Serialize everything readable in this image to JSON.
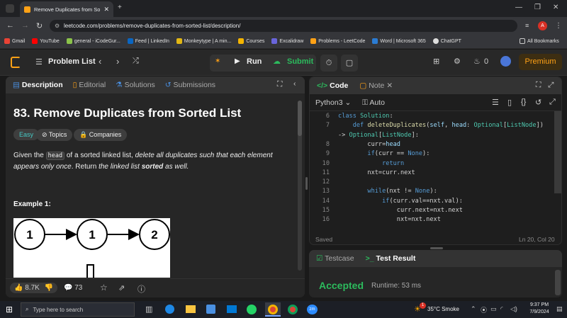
{
  "browser": {
    "tab_title": "Remove Duplicates from Sorte...",
    "url": "leetcode.com/problems/remove-duplicates-from-sorted-list/description/",
    "profile_initial": "A",
    "bookmarks": [
      "Gmail",
      "YouTube",
      "general - iCodeGur...",
      "Feed | LinkedIn",
      "Monkeytype | A min...",
      "Courses",
      "Excalidraw",
      "Problems - LeetCode",
      "Word | Microsoft 365",
      "ChatGPT"
    ],
    "all_bookmarks": "All Bookmarks"
  },
  "nav": {
    "problem_list": "Problem List",
    "run": "Run",
    "submit": "Submit",
    "streak": "0",
    "premium": "Premium"
  },
  "desc": {
    "tabs": [
      "Description",
      "Editorial",
      "Solutions",
      "Submissions"
    ],
    "title": "83. Remove Duplicates from Sorted List",
    "tag_easy": "Easy",
    "tag_topics": "Topics",
    "tag_companies": "Companies",
    "p_a": "Given the ",
    "p_code": "head",
    "p_b": " of a sorted linked list, ",
    "p_i1": "delete all duplicates such that each element appears only once",
    "p_c": ". Return ",
    "p_i2": "the linked list ",
    "p_bold": "sorted",
    "p_i3": " as well.",
    "example": "Example 1:",
    "diagram_nodes": [
      "1",
      "1",
      "2"
    ],
    "likes": "8.7K",
    "comments": "73"
  },
  "code": {
    "tab_code": "Code",
    "tab_note": "Note",
    "lang": "Python3",
    "auto": "Auto",
    "lines": [
      {
        "n": "6",
        "t": "class Solution:"
      },
      {
        "n": "7",
        "t": "    def deleteDuplicates(self, head: Optional[ListNode])"
      },
      {
        "n": "",
        "t": "-> Optional[ListNode]:"
      },
      {
        "n": "8",
        "t": "        curr=head"
      },
      {
        "n": "9",
        "t": "        if(curr == None):"
      },
      {
        "n": "10",
        "t": "            return"
      },
      {
        "n": "11",
        "t": "        nxt=curr.next"
      },
      {
        "n": "12",
        "t": ""
      },
      {
        "n": "13",
        "t": "        while(nxt != None):"
      },
      {
        "n": "14",
        "t": "            if(curr.val==nxt.val):"
      },
      {
        "n": "15",
        "t": "                curr.next=nxt.next"
      },
      {
        "n": "16",
        "t": "                nxt=nxt.next"
      }
    ],
    "saved": "Saved",
    "cursor": "Ln 20, Col 20"
  },
  "test": {
    "tab_testcase": "Testcase",
    "tab_result": "Test Result",
    "status": "Accepted",
    "runtime": "Runtime: 53 ms"
  },
  "taskbar": {
    "search_placeholder": "Type here to search",
    "weather": "35°C  Smoke",
    "time": "9:37 PM",
    "date": "7/9/2024",
    "badge": "1"
  }
}
